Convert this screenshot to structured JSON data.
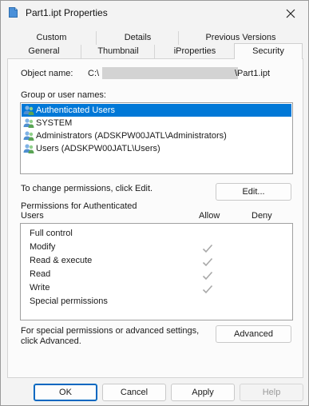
{
  "window": {
    "title": "Part1.ipt Properties"
  },
  "tabs_row1": [
    {
      "label": "Custom"
    },
    {
      "label": "Details"
    },
    {
      "label": "Previous Versions"
    }
  ],
  "tabs_row2": [
    {
      "label": "General"
    },
    {
      "label": "Thumbnail"
    },
    {
      "label": "iProperties"
    },
    {
      "label": "Security",
      "active": true
    }
  ],
  "security": {
    "object_name_label": "Object name:",
    "object_name_prefix": "C:\\",
    "object_name_suffix": "\\Part1.ipt",
    "groups_label": "Group or user names:",
    "groups": [
      {
        "name": "Authenticated Users",
        "selected": true
      },
      {
        "name": "SYSTEM"
      },
      {
        "name": "Administrators (ADSKPW00JATL\\Administrators)"
      },
      {
        "name": "Users (ADSKPW00JATL\\Users)"
      }
    ],
    "change_text": "To change permissions, click Edit.",
    "edit_button": "Edit...",
    "permissions_for_line1": "Permissions for Authenticated",
    "permissions_for_line2": "Users",
    "allow_header": "Allow",
    "deny_header": "Deny",
    "permissions": [
      {
        "name": "Full control",
        "allow": false,
        "deny": false
      },
      {
        "name": "Modify",
        "allow": true,
        "deny": false
      },
      {
        "name": "Read & execute",
        "allow": true,
        "deny": false
      },
      {
        "name": "Read",
        "allow": true,
        "deny": false
      },
      {
        "name": "Write",
        "allow": true,
        "deny": false
      },
      {
        "name": "Special permissions",
        "allow": false,
        "deny": false
      }
    ],
    "advanced_text_line1": "For special permissions or advanced settings,",
    "advanced_text_line2": "click Advanced.",
    "advanced_button": "Advanced"
  },
  "footer": {
    "ok": "OK",
    "cancel": "Cancel",
    "apply": "Apply",
    "help": "Help"
  },
  "colors": {
    "selection": "#0078d7",
    "check_grey": "#a8a8a8"
  },
  "icons": {
    "title": "file-icon",
    "close": "close-icon",
    "user_group": "user-group-icon",
    "checkmark": "checkmark-icon"
  }
}
